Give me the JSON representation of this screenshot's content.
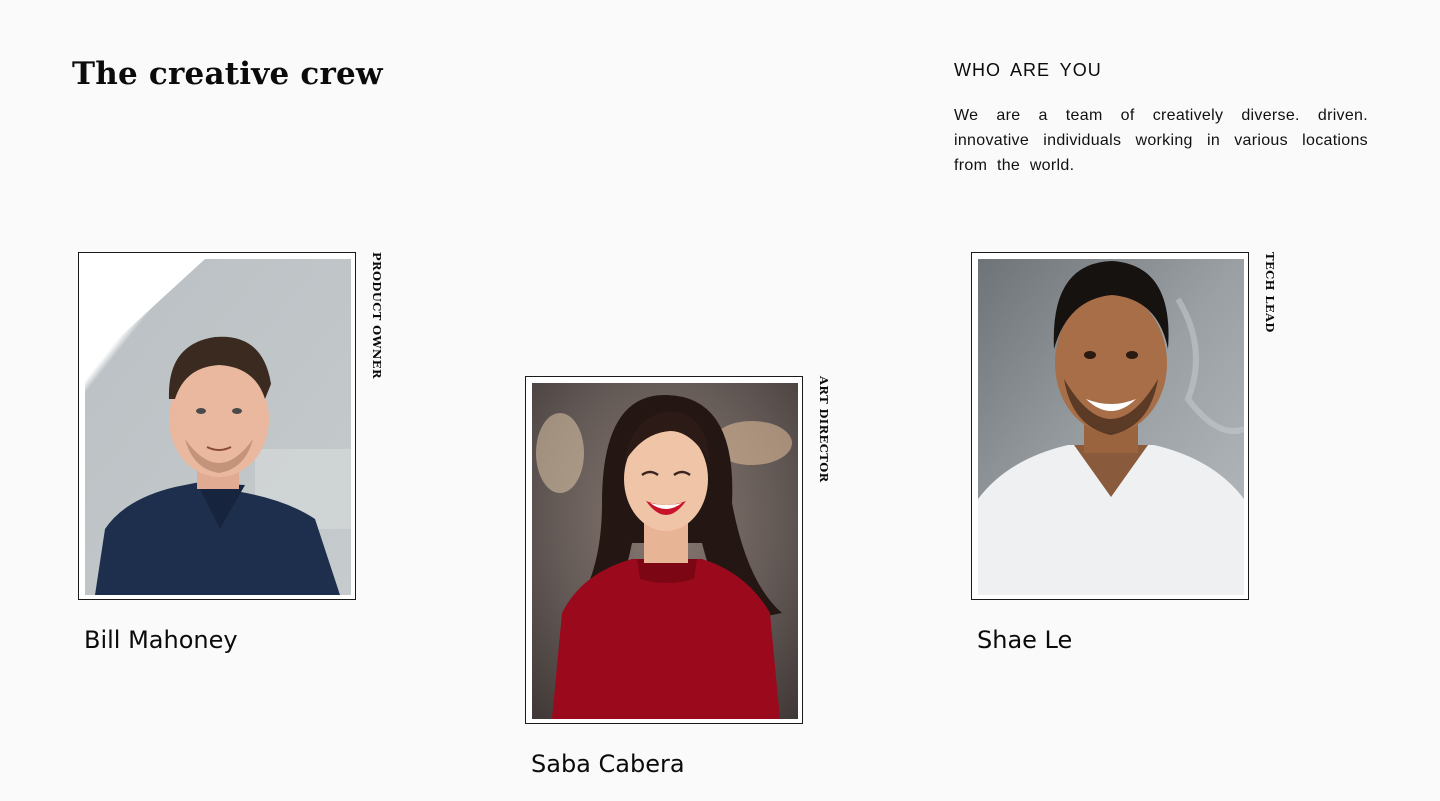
{
  "header": {
    "title": "The creative crew"
  },
  "intro": {
    "heading": "WHO ARE YOU",
    "text": "We are a team of creatively diverse. driven. innovative individuals working in various locations from the world."
  },
  "team": [
    {
      "name": "Bill Mahoney",
      "role": "PRODUCT OWNER",
      "photo": "portrait-man-navy-polo"
    },
    {
      "name": "Saba Cabera",
      "role": "ART DIRECTOR",
      "photo": "portrait-woman-red-sweater"
    },
    {
      "name": "Shae Le",
      "role": "TECH LEAD",
      "photo": "portrait-man-white-tshirt"
    }
  ],
  "colors": {
    "background": "#fafafa",
    "text": "#0b0b0b",
    "frame_border": "#1a1a1a"
  }
}
